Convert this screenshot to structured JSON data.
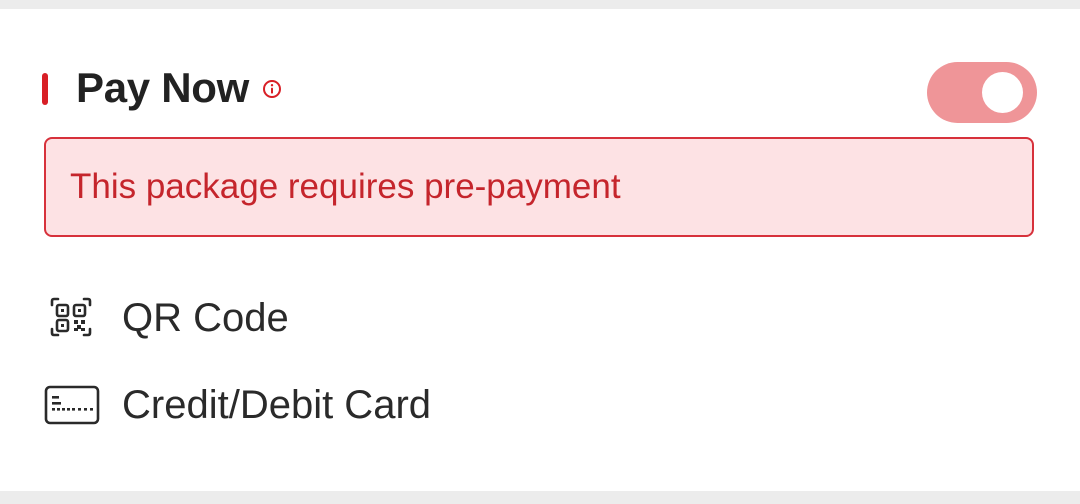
{
  "pay_now": {
    "title": "Pay Now",
    "info_icon": "info-circle-icon",
    "toggle_on": true
  },
  "alert": {
    "message": "This package requires pre-payment"
  },
  "payment_methods": [
    {
      "label": "QR Code",
      "icon": "qr-code-icon"
    },
    {
      "label": "Credit/Debit Card",
      "icon": "credit-card-icon"
    }
  ],
  "colors": {
    "accent": "#d81f26",
    "toggle_track": "#ef9598",
    "alert_background": "#fde2e4",
    "alert_border": "#d7313b",
    "alert_text": "#c5252c"
  }
}
